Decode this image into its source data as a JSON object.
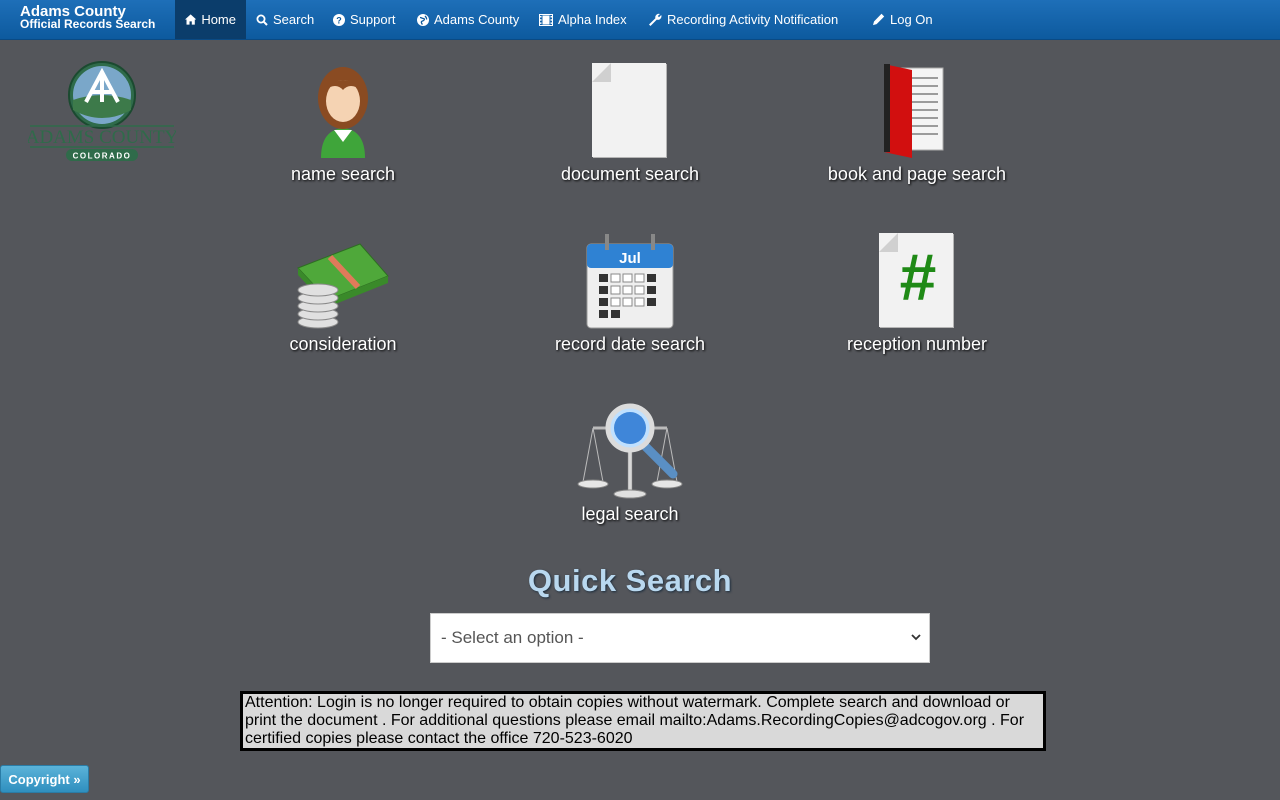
{
  "brand": {
    "line1": "Adams County",
    "line2": "Official Records Search"
  },
  "nav": {
    "home": "Home",
    "search": "Search",
    "support": "Support",
    "county": "Adams County",
    "alpha": "Alpha Index",
    "notify": "Recording Activity Notification",
    "login": "Log On"
  },
  "logo": {
    "name": "ADAMS COUNTY",
    "state": "COLORADO"
  },
  "tiles": {
    "name": "name search",
    "document": "document search",
    "book": "book and page search",
    "consideration": "consideration",
    "record_date": "record date search",
    "reception": "reception number",
    "legal": "legal search"
  },
  "icons": {
    "calendar_month": "Jul",
    "reception_symbol": "#"
  },
  "quick_search": {
    "title": "Quick Search",
    "selected": "- Select an option -"
  },
  "notice": "Attention: Login is no longer required to obtain copies without watermark. Complete search and download or print the document . For additional questions please email mailto:Adams.RecordingCopies@adcogov.org . For certified copies please contact the office 720-523-6020",
  "footer": {
    "copyright": "Copyright »"
  },
  "colors": {
    "background": "#54565b",
    "navbar": "#0d5a9e",
    "title": "#b9d8ef"
  }
}
